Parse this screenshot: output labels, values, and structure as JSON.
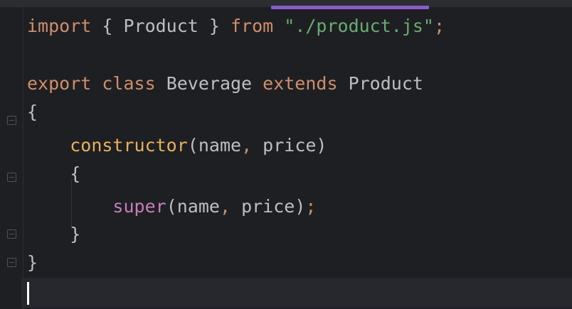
{
  "editor": {
    "language": "javascript",
    "colors": {
      "background": "#1e1f22",
      "keyword": "#cf8e6d",
      "string": "#6aab73",
      "method": "#e5b15e",
      "super": "#c77dbb",
      "text": "#bcbec4",
      "tab_indicator": "#8b5cc9"
    },
    "lines": [
      {
        "tokens": [
          {
            "t": "import",
            "k": "kw"
          },
          {
            "t": " { Product } ",
            "k": "plain"
          },
          {
            "t": "from",
            "k": "kw"
          },
          {
            "t": " ",
            "k": "plain"
          },
          {
            "t": "\"./product.js\"",
            "k": "str"
          },
          {
            "t": ";",
            "k": "kw"
          }
        ]
      },
      {
        "tokens": []
      },
      {
        "tokens": [
          {
            "t": "export",
            "k": "kw"
          },
          {
            "t": " ",
            "k": "plain"
          },
          {
            "t": "class",
            "k": "kw"
          },
          {
            "t": " Beverage ",
            "k": "plain"
          },
          {
            "t": "extends",
            "k": "kw"
          },
          {
            "t": " Product",
            "k": "plain"
          }
        ]
      },
      {
        "tokens": [
          {
            "t": "{",
            "k": "plain"
          }
        ]
      },
      {
        "tokens": [
          {
            "t": "    ",
            "k": "plain"
          },
          {
            "t": "constructor",
            "k": "fn"
          },
          {
            "t": "(name",
            "k": "plain"
          },
          {
            "t": ",",
            "k": "kw"
          },
          {
            "t": " price)",
            "k": "plain"
          }
        ]
      },
      {
        "tokens": [
          {
            "t": "    {",
            "k": "plain"
          }
        ]
      },
      {
        "tokens": [
          {
            "t": "        ",
            "k": "plain"
          },
          {
            "t": "super",
            "k": "sup"
          },
          {
            "t": "(name",
            "k": "plain"
          },
          {
            "t": ",",
            "k": "kw"
          },
          {
            "t": " price)",
            "k": "plain"
          },
          {
            "t": ";",
            "k": "kw"
          }
        ]
      },
      {
        "tokens": [
          {
            "t": "    }",
            "k": "plain"
          }
        ]
      },
      {
        "tokens": [
          {
            "t": "}",
            "k": "plain"
          }
        ]
      }
    ]
  }
}
